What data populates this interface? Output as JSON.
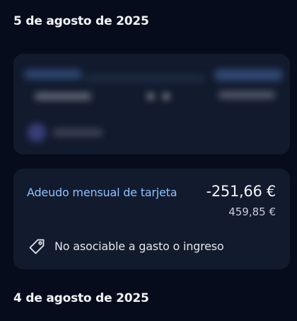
{
  "groups": [
    {
      "date": "5 de agosto de 2025",
      "transaction": {
        "name": "Adeudo mensual de tarjeta",
        "amount": "-251,66 €",
        "balance": "459,85 €",
        "category_tag": "No asociable a gasto o ingreso",
        "category_icon": "tag-icon"
      }
    },
    {
      "date": "4 de agosto de 2025"
    }
  ],
  "colors": {
    "background": "#070c1c",
    "card": "#121a2d",
    "accent_link": "#8ec0ff"
  }
}
